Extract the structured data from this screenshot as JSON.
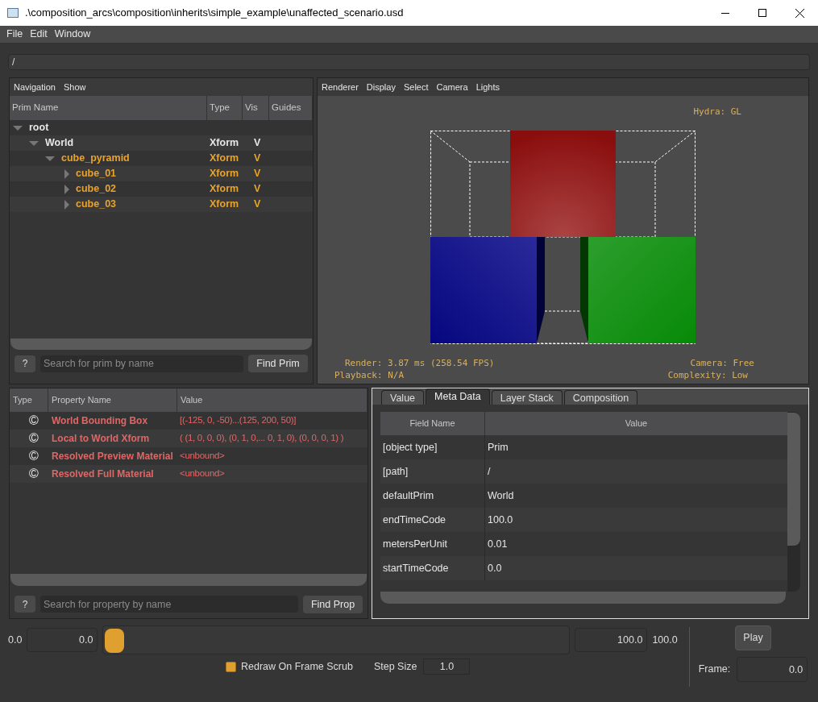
{
  "window": {
    "title": ".\\composition_arcs\\composition\\inherits\\simple_example\\unaffected_scenario.usd"
  },
  "menu": [
    "File",
    "Edit",
    "Window"
  ],
  "path_field": {
    "value": "/"
  },
  "prim_panel": {
    "menu": [
      "Navigation",
      "Show"
    ],
    "columns": [
      "Prim Name",
      "Type",
      "Vis",
      "Guides"
    ],
    "tree": [
      {
        "name": "root",
        "expanded": true,
        "color": "#e6e6e6",
        "children": [
          {
            "name": "World",
            "type": "Xform",
            "vis": "V",
            "expanded": true,
            "color": "#e6e6e6",
            "children": [
              {
                "name": "cube_pyramid",
                "type": "Xform",
                "vis": "V",
                "expanded": true,
                "color": "#e8a22e",
                "children": [
                  {
                    "name": "cube_01",
                    "type": "Xform",
                    "vis": "V",
                    "expanded": false,
                    "color": "#e8a22e"
                  },
                  {
                    "name": "cube_02",
                    "type": "Xform",
                    "vis": "V",
                    "expanded": false,
                    "color": "#e8a22e"
                  },
                  {
                    "name": "cube_03",
                    "type": "Xform",
                    "vis": "V",
                    "expanded": false,
                    "color": "#e8a22e"
                  }
                ]
              }
            ]
          }
        ]
      }
    ],
    "help_button": "?",
    "search": {
      "placeholder": "Search for prim by name"
    },
    "find_button": "Find Prim"
  },
  "viewport": {
    "menu": [
      "Renderer",
      "Display",
      "Select",
      "Camera",
      "Lights"
    ],
    "hud": {
      "renderer": "Hydra: GL",
      "render": "Render: 3.87 ms (258.54 FPS)",
      "playback": "Playback: N/A",
      "camera": "Camera: Free",
      "complexity": "Complexity: Low"
    }
  },
  "property_panel": {
    "columns": [
      "Type",
      "Property Name",
      "Value"
    ],
    "rows": [
      {
        "type_icon": "©",
        "name": "World Bounding Box",
        "value": "[(-125, 0, -50)...(125, 200, 50)]"
      },
      {
        "type_icon": "©",
        "name": "Local to World Xform",
        "value": "( (1, 0, 0, 0), (0, 1, 0,... 0, 1, 0), (0, 0, 0, 1) )"
      },
      {
        "type_icon": "©",
        "name": "Resolved Preview Material",
        "value": "<unbound>"
      },
      {
        "type_icon": "©",
        "name": "Resolved Full Material",
        "value": "<unbound>"
      }
    ],
    "help_button": "?",
    "search": {
      "placeholder": "Search for property by name"
    },
    "find_button": "Find Prop"
  },
  "inspector": {
    "tabs": [
      {
        "label": "Value",
        "selected": false
      },
      {
        "label": "Meta Data",
        "selected": true
      },
      {
        "label": "Layer Stack",
        "selected": false
      },
      {
        "label": "Composition",
        "selected": false
      }
    ],
    "columns": [
      "Field Name",
      "Value"
    ],
    "rows": [
      {
        "field": "[object type]",
        "value": "Prim"
      },
      {
        "field": "[path]",
        "value": "/"
      },
      {
        "field": "defaultPrim",
        "value": "World"
      },
      {
        "field": "endTimeCode",
        "value": "100.0"
      },
      {
        "field": "metersPerUnit",
        "value": "0.01"
      },
      {
        "field": "startTimeCode",
        "value": "0.0"
      }
    ]
  },
  "timeline": {
    "start_label": "0.0",
    "start_value": "0.0",
    "slider": {
      "level": 0
    },
    "end_value": "100.0",
    "end_label": "100.0",
    "redraw_checkbox": {
      "label": "Redraw On Frame Scrub",
      "checked": true
    },
    "step_label": "Step Size",
    "step_value": "1.0",
    "play_button": "Play",
    "frame_label": "Frame:",
    "frame_value": "0.0"
  }
}
